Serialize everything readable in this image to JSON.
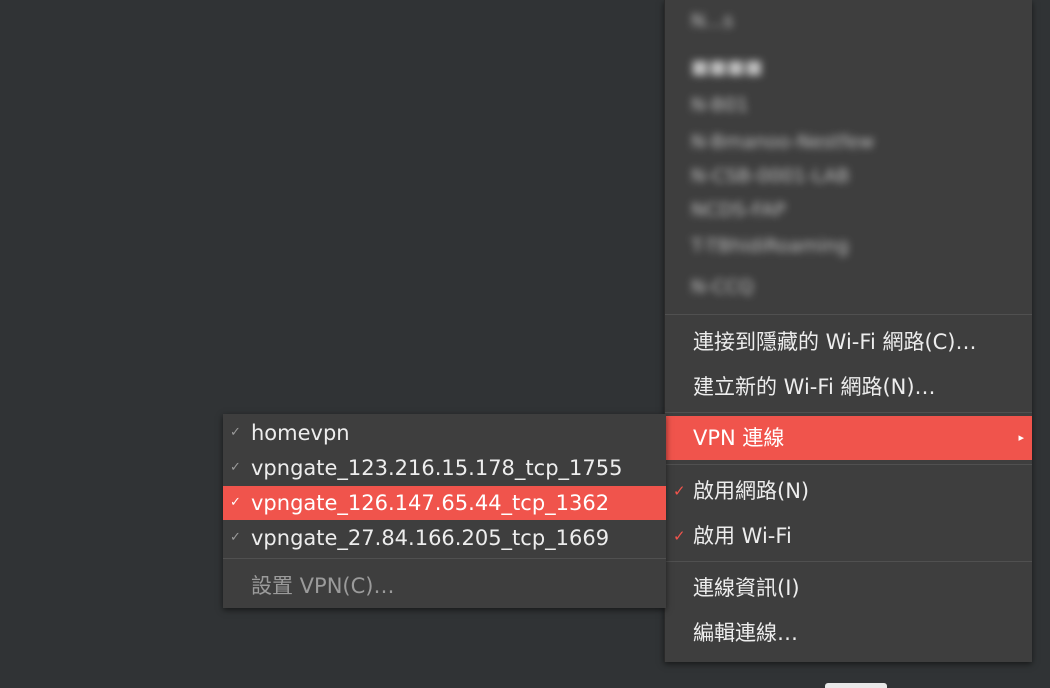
{
  "network_menu": {
    "hidden_networks": [
      "N...s",
      "■■■■",
      "N-B01",
      "N-Bmanoo-Nestfew",
      "N-CSB-0001-LAB",
      "NCDS-FAP",
      "T-TBhidiRoaming",
      "N-CCQ"
    ],
    "connect_hidden_label": "連接到隱藏的 Wi-Fi 網路(C)…",
    "create_new_label": "建立新的 Wi-Fi 網路(N)…",
    "vpn_label": "VPN 連線",
    "vpn_arrow": "▸",
    "enable_network_label": "啟用網路(N)",
    "enable_wifi_label": "啟用 Wi-Fi",
    "connection_info_label": "連線資訊(I)",
    "edit_connections_label": "編輯連線…",
    "check_glyph": "✓"
  },
  "vpn_submenu": {
    "items": [
      {
        "label": "homevpn"
      },
      {
        "label": "vpngate_123.216.15.178_tcp_1755"
      },
      {
        "label": "vpngate_126.147.65.44_tcp_1362"
      },
      {
        "label": "vpngate_27.84.166.205_tcp_1669"
      }
    ],
    "configure_label": "設置 VPN(C)…",
    "check_glyph": "✓"
  },
  "colors": {
    "accent": "#f0544c",
    "menu_bg": "#3e3e3e",
    "desktop_bg": "#303335"
  }
}
